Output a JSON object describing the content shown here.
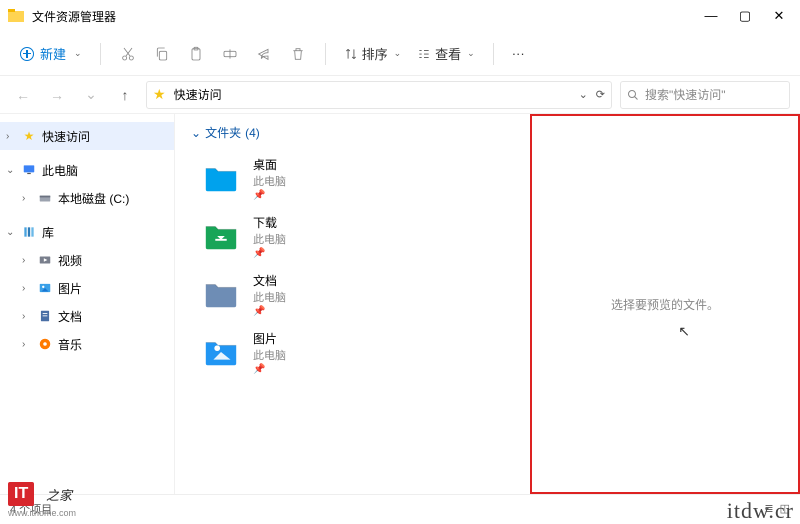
{
  "title": "文件资源管理器",
  "window_controls": {
    "min": "—",
    "max": "▢",
    "close": "✕"
  },
  "toolbar": {
    "new": "新建",
    "sort": "排序",
    "view": "查看",
    "more": "···"
  },
  "nav": {
    "back": "←",
    "fwd": "→",
    "up": "↑",
    "dropdown": "⌄",
    "refresh": "⟳"
  },
  "address": {
    "label": "快速访问"
  },
  "search": {
    "placeholder": "搜索\"快速访问\""
  },
  "sidebar": [
    {
      "label": "快速访问",
      "level": 0,
      "expand": "right",
      "icon": "star",
      "sel": true
    },
    {
      "spacer": true
    },
    {
      "label": "此电脑",
      "level": 0,
      "expand": "down",
      "icon": "pc"
    },
    {
      "label": "本地磁盘 (C:)",
      "level": 1,
      "expand": "right",
      "icon": "disk"
    },
    {
      "spacer": true
    },
    {
      "label": "库",
      "level": 0,
      "expand": "down",
      "icon": "lib"
    },
    {
      "label": "视频",
      "level": 1,
      "expand": "right",
      "icon": "video"
    },
    {
      "label": "图片",
      "level": 1,
      "expand": "right",
      "icon": "pic"
    },
    {
      "label": "文档",
      "level": 1,
      "expand": "right",
      "icon": "doc"
    },
    {
      "label": "音乐",
      "level": 1,
      "expand": "right",
      "icon": "music"
    }
  ],
  "group": {
    "label": "文件夹",
    "count": "(4)"
  },
  "items": [
    {
      "name": "桌面",
      "sub": "此电脑",
      "pinned": true,
      "color": "#00a2ed"
    },
    {
      "name": "下载",
      "sub": "此电脑",
      "pinned": true,
      "color": "#18a558"
    },
    {
      "name": "文档",
      "sub": "此电脑",
      "pinned": true,
      "color": "#6e8db5"
    },
    {
      "name": "图片",
      "sub": "此电脑",
      "pinned": true,
      "color": "#2196f3"
    }
  ],
  "preview_empty_text": "选择要预览的文件。",
  "status": {
    "count": "4 个项目"
  },
  "watermark": {
    "logo": "IT",
    "logo_sub": "之家",
    "url_small": "www.ithome.com",
    "url_big": "itdw.cr"
  }
}
